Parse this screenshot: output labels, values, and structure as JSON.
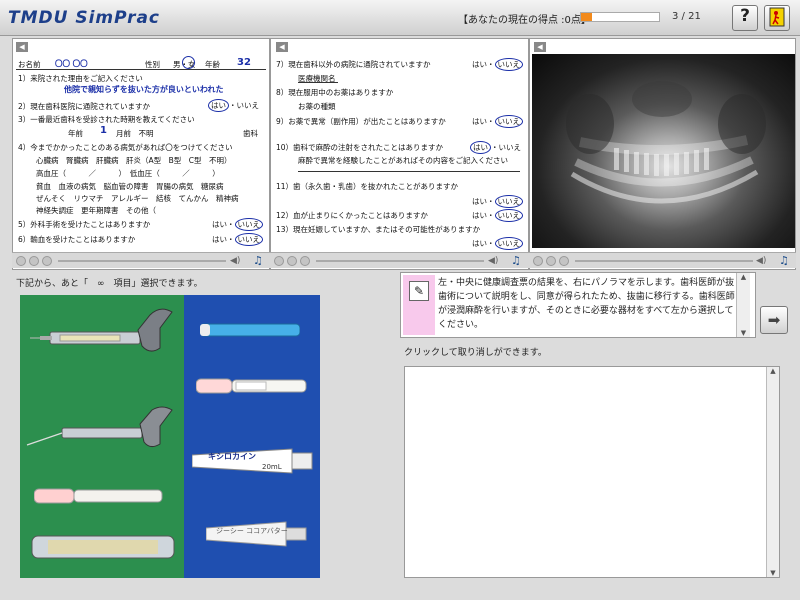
{
  "header": {
    "logo": "TMDU SimPrac",
    "score_label": "【あなたの現在の得点 :0点】",
    "progress": {
      "current": 3,
      "total": 21,
      "fraction": 0.143
    },
    "progress_text": "3 / 21",
    "help_label": "?",
    "exit_icon": "exit-door-icon",
    "accent": "#f28a1c"
  },
  "questionnaire": {
    "name_label": "お名前",
    "name_value": "〇〇 〇〇",
    "sex_label": "性別",
    "sex_options": "男・女",
    "sex_selected": "女",
    "age_label": "年齢",
    "age_value": "32",
    "q1": "1）来院された理由をご記入ください",
    "q1_answer": "他院で親知らずを抜いた方が良いといわれた",
    "q2": "2）現在歯科医院に通院されていますか",
    "q3": "3）一番最近歯科を受診された時期を教えてください",
    "q3_prefix": "年前",
    "q3_month": "1",
    "q3_suffix": "月前　不明",
    "q3_tail": "歯科",
    "q4": "4）今までかかったことのある病気があれば〇をつけてください",
    "q4_row1": "心臓病　腎臓病　肝臓病　肝炎（A型　B型　C型　不明）",
    "q4_row2": "高血圧（　　　／　　　）　低血圧（　　　／　　　）",
    "q4_row3": "貧血　血液の病気　脳血管の障害　胃腸の病気　糖尿病",
    "q4_row4": "ぜんそく　リウマチ　アレルギー　結核　てんかん　精神病",
    "q4_row5": "神経失調症　更年期障害　その他（",
    "q5": "5）外科手術を受けたことはありますか",
    "q6": "6）輸血を受けたことはありますか",
    "q7": "7）現在歯科以外の病院に通院されていますか",
    "q7_sub": "医療機関名",
    "q8": "8）現在服用中のお薬はありますか",
    "q8_sub": "お薬の種類",
    "q9": "9）お薬で異常（副作用）が出たことはありますか",
    "q10": "10）歯科で麻酔の注射をされたことはありますか",
    "q10_sub1": "麻酔で異常を経験したことがあればその内容をご記入ください",
    "q11": "11）歯（永久歯・乳歯）を抜かれたことがありますか",
    "q12": "12）血が止まりにくかったことはありますか",
    "q13": "13）現在妊娠していますか、またはその可能性がありますか",
    "yes": "はい",
    "no": "いいえ"
  },
  "instructions": {
    "count_text": "下記から、あと「　∞　項目」選択できます。",
    "body": "左・中央に健康調査票の結果を、右にパノラマを示します。歯科医師が抜歯術について説明をし、同意が得られたため、抜歯に移行する。歯科医師が浸潤麻酔を行いますが、そのときに必要な器材をすべて左から選択してください。"
  },
  "selection": {
    "hint": "クリックして取り消しができます。"
  },
  "products": {
    "lidocaine_label": "キシロカイン",
    "lidocaine_sub": "20mL",
    "topical_label": "ジーシー ココアバター"
  }
}
